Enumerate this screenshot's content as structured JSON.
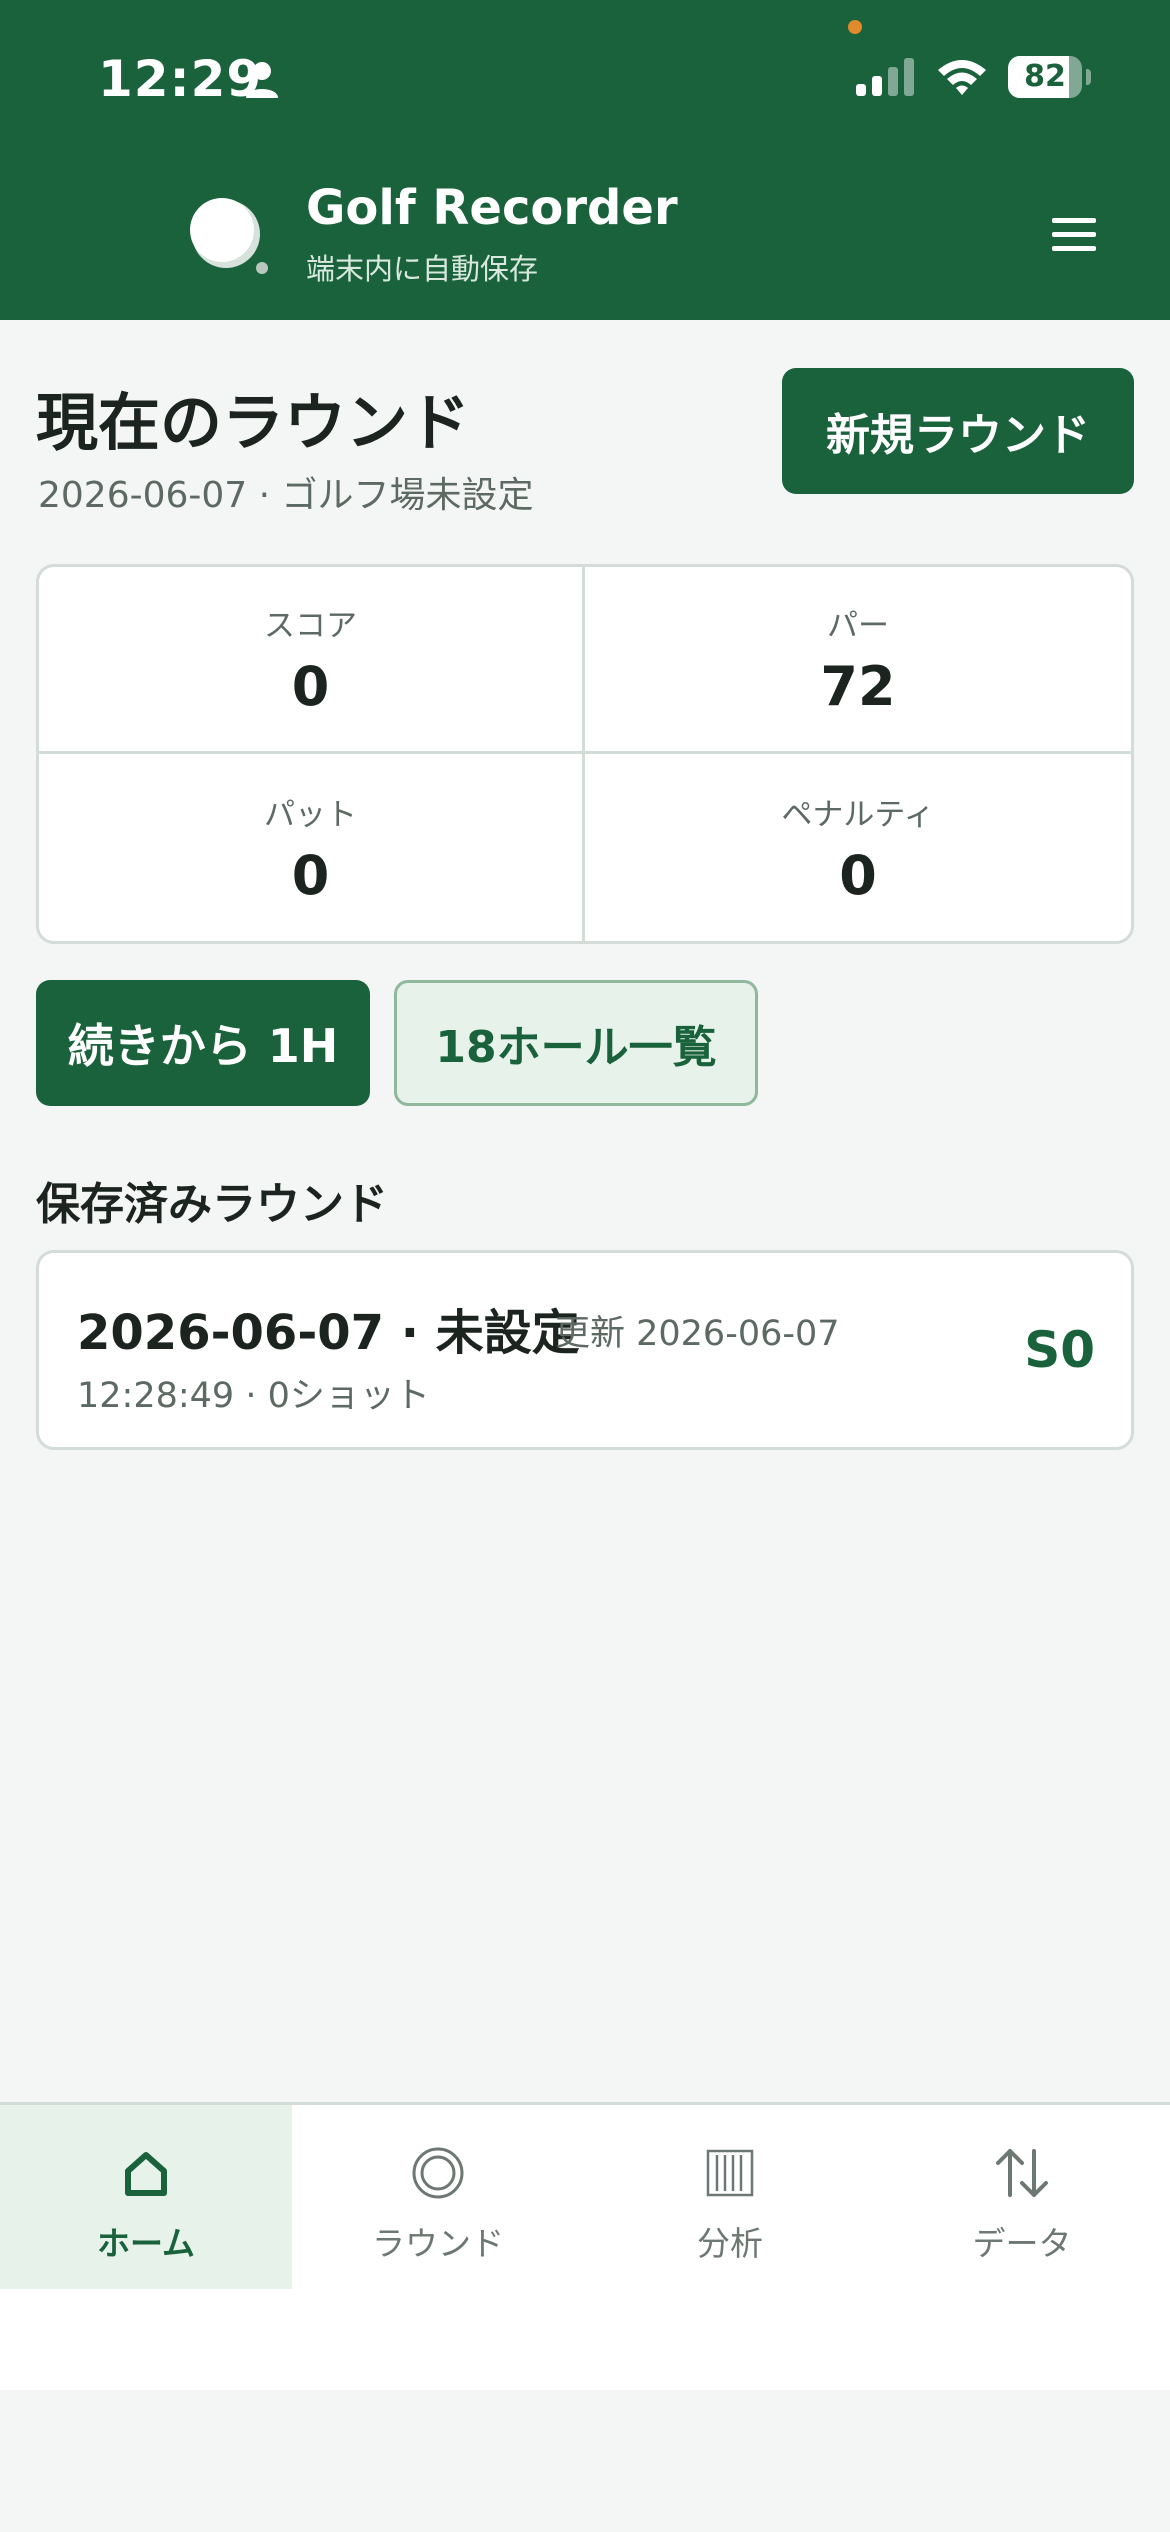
{
  "status_bar": {
    "time": "12:29",
    "battery_level": "82",
    "battery_fraction": 0.82
  },
  "header": {
    "title": "Golf Recorder",
    "subtitle": "端末内に自動保存"
  },
  "current_round": {
    "title": "現在のラウンド",
    "subtitle": "2026-06-07 · ゴルフ場未設定",
    "new_round_label": "新規ラウンド"
  },
  "stats": [
    {
      "label": "スコア",
      "value": "0"
    },
    {
      "label": "パー",
      "value": "72"
    },
    {
      "label": "パット",
      "value": "0"
    },
    {
      "label": "ペナルティ",
      "value": "0"
    }
  ],
  "actions": {
    "continue_label": "続きから 1H",
    "holes_label": "18ホール一覧"
  },
  "saved_rounds": {
    "title": "保存済みラウンド",
    "items": [
      {
        "title": "2026-06-07 · 未設定",
        "updated": "更新 2026-06-07",
        "meta": "12:28:49 · 0ショット",
        "score": "S0"
      }
    ]
  },
  "nav": {
    "items": [
      {
        "label": "ホーム",
        "icon": "home-icon",
        "active": true
      },
      {
        "label": "ラウンド",
        "icon": "target-icon",
        "active": false
      },
      {
        "label": "分析",
        "icon": "barcode-chart-icon",
        "active": false
      },
      {
        "label": "データ",
        "icon": "transfer-arrows-icon",
        "active": false
      }
    ]
  },
  "colors": {
    "brand_green": "#1a623c",
    "accent_light": "#e6f2ea",
    "background": "#f3f6f4",
    "status_dot": "#e08a2c"
  }
}
